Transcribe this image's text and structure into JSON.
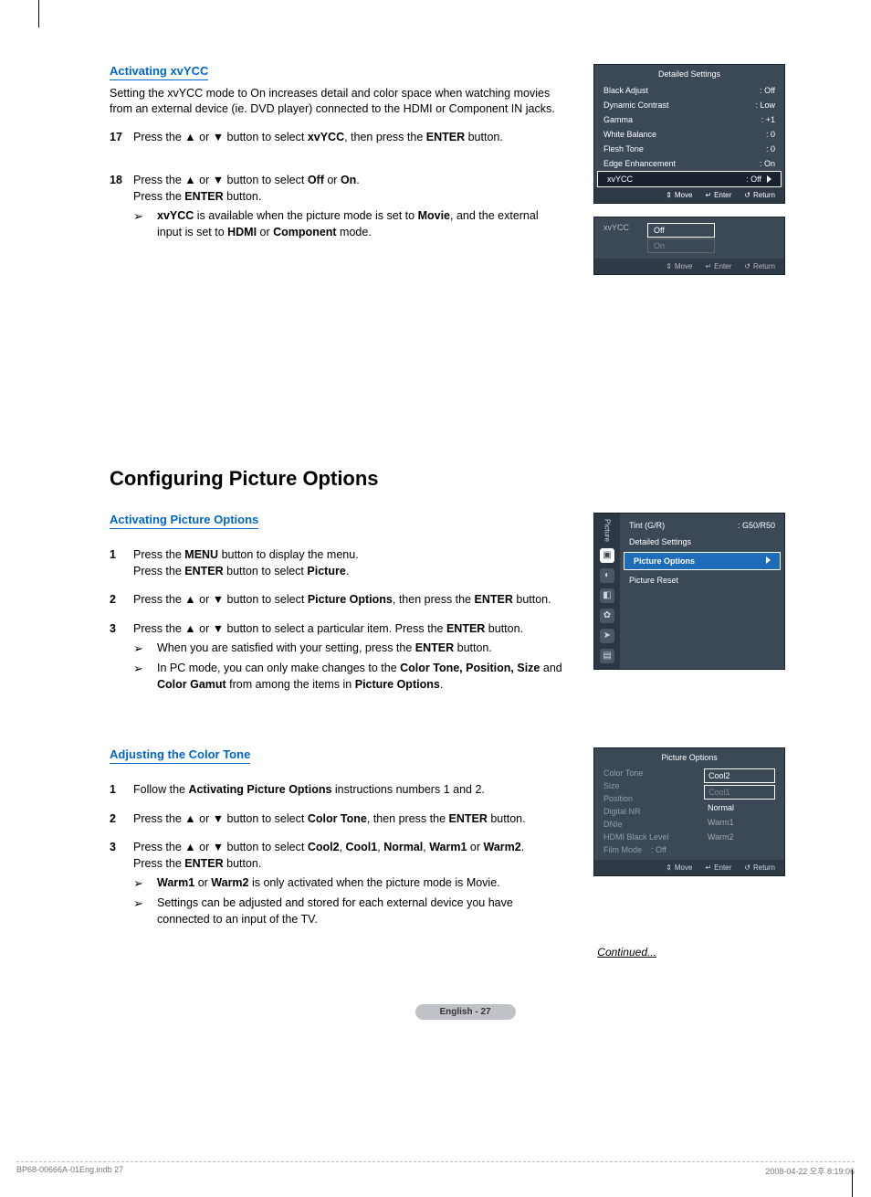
{
  "section1": {
    "title": "Activating xvYCC",
    "intro": "Setting the xvYCC mode to On increases detail and color space when watching movies from an external device (ie. DVD player) connected to the HDMI or Component IN jacks.",
    "step17_num": "17",
    "step17": "Press the ▲ or ▼ button to select xvYCC, then press the ENTER button.",
    "step18_num": "18",
    "step18a": "Press the ▲ or ▼ button to select Off or On.",
    "step18b": "Press the ENTER button.",
    "step18_note": "xvYCC is available when the picture mode is set to Movie, and the external input is set to HDMI or Component mode."
  },
  "osd1": {
    "title": "Detailed Settings",
    "rows": [
      {
        "label": "Black Adjust",
        "val": ": Off"
      },
      {
        "label": "Dynamic Contrast",
        "val": ": Low"
      },
      {
        "label": "Gamma",
        "val": ": +1"
      },
      {
        "label": "White Balance",
        "val": ": 0"
      },
      {
        "label": "Flesh Tone",
        "val": ": 0"
      },
      {
        "label": "Edge Enhancement",
        "val": ": On"
      }
    ],
    "selected": {
      "label": "xvYCC",
      "val": ": Off"
    },
    "footer": {
      "move": "Move",
      "enter": "Enter",
      "return": "Return"
    }
  },
  "osd2": {
    "label": "xvYCC",
    "opt_selected": "Off",
    "opt_dim": "On",
    "footer": {
      "move": "Move",
      "enter": "Enter",
      "return": "Return"
    }
  },
  "heading": "Configuring Picture Options",
  "section2": {
    "title": "Activating Picture Options",
    "s1_num": "1",
    "s1a": "Press the MENU button to display the menu.",
    "s1b": "Press the ENTER button to select Picture.",
    "s2_num": "2",
    "s2": "Press the ▲ or ▼ button to select Picture Options, then press the ENTER button.",
    "s3_num": "3",
    "s3": "Press the ▲ or ▼ button to select a particular item. Press the ENTER button.",
    "s3_n1": "When you are satisfied with your setting, press the ENTER button.",
    "s3_n2": "In PC mode, you can only make changes to the Color Tone, Position, Size and Color Gamut from among the items in Picture Options."
  },
  "osd3": {
    "side_label": "Picture",
    "row_tint_label": "Tint (G/R)",
    "row_tint_val": ": G50/R50",
    "row_ds": "Detailed Settings",
    "row_po": "Picture Options",
    "row_pr": "Picture Reset"
  },
  "section3": {
    "title": "Adjusting the Color Tone",
    "s1_num": "1",
    "s1": "Follow the Activating Picture Options instructions numbers 1 and 2.",
    "s2_num": "2",
    "s2": "Press the ▲ or ▼ button to select Color Tone, then press the ENTER button.",
    "s3_num": "3",
    "s3a": "Press the ▲ or ▼ button to select Cool2, Cool1, Normal, Warm1 or Warm2.",
    "s3b": "Press the ENTER button.",
    "s3_n1": "Warm1 or Warm2 is only activated when the picture mode is Movie.",
    "s3_n2": "Settings can be adjusted and stored for each external device you have connected to an input of the TV."
  },
  "osd4": {
    "title": "Picture Options",
    "left": [
      "Color Tone",
      "Size",
      "Position",
      "Digital NR",
      "DNIe",
      "HDMI Black Level",
      "Film Mode"
    ],
    "film_val": ": Off",
    "opts": [
      "Cool2",
      "Cool1",
      "Normal",
      "Warm1",
      "Warm2"
    ],
    "footer": {
      "move": "Move",
      "enter": "Enter",
      "return": "Return"
    }
  },
  "continued": "Continued...",
  "page_pill": "English - 27",
  "footer_left": "BP68-00666A-01Eng.indb   27",
  "footer_right": "2008-04-22   오후 8:19:06",
  "glyphs": {
    "arrow": "➢",
    "updown": "⇕",
    "enter": "↵",
    "return": "↺"
  }
}
